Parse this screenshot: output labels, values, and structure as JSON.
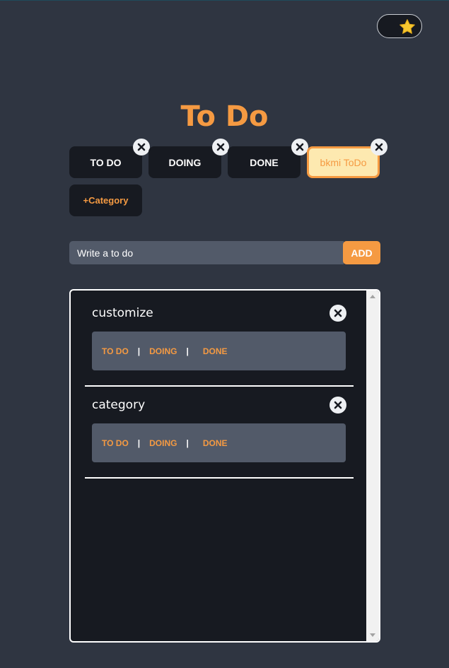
{
  "title": "To Do",
  "categories": [
    {
      "label": "TO DO"
    },
    {
      "label": "DOING"
    },
    {
      "label": "DONE"
    },
    {
      "label": "bkmi ToDo"
    }
  ],
  "add_category_label": "+Category",
  "input": {
    "placeholder": "Write a to do",
    "value": ""
  },
  "add_button_label": "ADD",
  "items": [
    {
      "title": "customize",
      "actions": [
        "TO DO",
        "DOING",
        "DONE"
      ]
    },
    {
      "title": "category",
      "actions": [
        "TO DO",
        "DOING",
        "DONE"
      ]
    }
  ],
  "separator": "|",
  "icons": {
    "theme": "star-icon",
    "close": "close-icon"
  },
  "colors": {
    "accent": "#f59a42",
    "background": "#2f3541",
    "panel": "#171a21",
    "active_bg": "#fde9b0"
  }
}
